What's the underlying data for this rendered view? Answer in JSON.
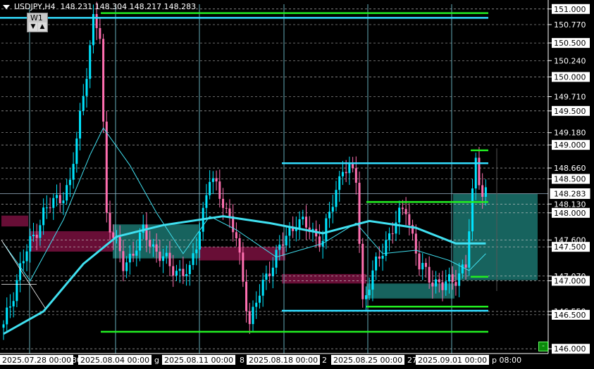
{
  "header": {
    "symbol_tf": "USDJPY,H4",
    "ohlc": "148.231 148.304 148.217 148.283"
  },
  "panel": {
    "label": "W1",
    "down_arrow": "▼",
    "up_arrow": "▲"
  },
  "colors": {
    "background": "#000000",
    "bull": "#00e5ff",
    "bear": "#ff6fb0",
    "ma_fast": "#40e0f0",
    "ma_slow": "#40e0f0",
    "level_cyan": "#33ddff",
    "level_green": "#22ee22",
    "zone_teal": "#1a6e68",
    "zone_maroon": "#7a1040",
    "price_tag_bg": "#ffffff"
  },
  "chart_data": {
    "type": "candlestick",
    "y_range": [
      145.93,
      151.07
    ],
    "y_ticks": [
      "151.000",
      "150.770",
      "150.500",
      "150.240",
      "150.000",
      "149.710",
      "149.500",
      "149.180",
      "149.000",
      "148.660",
      "148.500",
      "148.130",
      "148.000",
      "147.600",
      "147.500",
      "147.070",
      "147.000",
      "146.550",
      "146.500",
      "146.000"
    ],
    "current_price": "148.283",
    "x_labels": [
      "2025.07.28 00:00",
      "2025.08.04 00:00",
      "2025.08.11 00:00",
      "2025.08.18 00:00",
      "2025.08.25 00:00",
      "2025.09.01 00:00"
    ],
    "x_label_fragments": [
      "30",
      "g",
      "8",
      "2",
      "27",
      "p 08:00"
    ],
    "bars_count": 161,
    "key_points": [
      {
        "bar": 0,
        "price": 146.3
      },
      {
        "bar": 5,
        "price": 147.2
      },
      {
        "bar": 12,
        "price": 148.0
      },
      {
        "bar": 20,
        "price": 148.4
      },
      {
        "bar": 27,
        "price": 150.8
      },
      {
        "bar": 29,
        "price": 150.6
      },
      {
        "bar": 31,
        "price": 148.0
      },
      {
        "bar": 36,
        "price": 147.2
      },
      {
        "bar": 42,
        "price": 147.7
      },
      {
        "bar": 50,
        "price": 147.2
      },
      {
        "bar": 56,
        "price": 147.1
      },
      {
        "bar": 62,
        "price": 148.5
      },
      {
        "bar": 66,
        "price": 148.2
      },
      {
        "bar": 70,
        "price": 147.6
      },
      {
        "bar": 74,
        "price": 146.4
      },
      {
        "bar": 80,
        "price": 147.2
      },
      {
        "bar": 88,
        "price": 147.9
      },
      {
        "bar": 96,
        "price": 147.6
      },
      {
        "bar": 102,
        "price": 148.7
      },
      {
        "bar": 106,
        "price": 148.5
      },
      {
        "bar": 108,
        "price": 146.7
      },
      {
        "bar": 115,
        "price": 147.6
      },
      {
        "bar": 121,
        "price": 148.1
      },
      {
        "bar": 125,
        "price": 147.2
      },
      {
        "bar": 132,
        "price": 146.9
      },
      {
        "bar": 139,
        "price": 147.2
      },
      {
        "bar": 142,
        "price": 148.8
      },
      {
        "bar": 144,
        "price": 148.3
      },
      {
        "bar": 145,
        "price": 148.28
      }
    ],
    "ma_slow": [
      {
        "bar": 0,
        "price": 146.22
      },
      {
        "bar": 12,
        "price": 146.55
      },
      {
        "bar": 24,
        "price": 147.25
      },
      {
        "bar": 34,
        "price": 147.65
      },
      {
        "bar": 48,
        "price": 147.82
      },
      {
        "bar": 66,
        "price": 147.95
      },
      {
        "bar": 80,
        "price": 147.85
      },
      {
        "bar": 96,
        "price": 147.7
      },
      {
        "bar": 110,
        "price": 147.88
      },
      {
        "bar": 124,
        "price": 147.78
      },
      {
        "bar": 136,
        "price": 147.55
      },
      {
        "bar": 145,
        "price": 147.55
      }
    ],
    "ma_fast": [
      {
        "bar": 0,
        "price": 147.55
      },
      {
        "bar": 8,
        "price": 147.0
      },
      {
        "bar": 18,
        "price": 147.9
      },
      {
        "bar": 26,
        "price": 148.85
      },
      {
        "bar": 30,
        "price": 149.25
      },
      {
        "bar": 38,
        "price": 148.7
      },
      {
        "bar": 46,
        "price": 148.0
      },
      {
        "bar": 54,
        "price": 147.4
      },
      {
        "bar": 62,
        "price": 147.95
      },
      {
        "bar": 70,
        "price": 147.75
      },
      {
        "bar": 82,
        "price": 147.35
      },
      {
        "bar": 96,
        "price": 147.55
      },
      {
        "bar": 106,
        "price": 147.85
      },
      {
        "bar": 114,
        "price": 147.4
      },
      {
        "bar": 124,
        "price": 147.45
      },
      {
        "bar": 134,
        "price": 147.3
      },
      {
        "bar": 140,
        "price": 147.15
      },
      {
        "bar": 145,
        "price": 147.4
      }
    ],
    "levels": [
      {
        "color": "cyan",
        "price": 150.87,
        "from": 0,
        "to": 693
      },
      {
        "color": "green",
        "price": 150.94,
        "from": 143,
        "to": 693
      },
      {
        "color": "cyan",
        "price": 148.73,
        "from": 400,
        "to": 693
      },
      {
        "color": "green",
        "price": 148.16,
        "from": 520,
        "to": 693
      },
      {
        "color": "green",
        "price": 147.06,
        "from": 668,
        "to": 693
      },
      {
        "color": "cyan",
        "price": 146.56,
        "from": 400,
        "to": 693
      },
      {
        "color": "green",
        "price": 146.62,
        "from": 520,
        "to": 693
      },
      {
        "color": "green",
        "price": 146.25,
        "from": 143,
        "to": 693
      },
      {
        "color": "green",
        "price": 148.92,
        "from": 668,
        "to": 693
      }
    ],
    "zones": [
      {
        "kind": "teal",
        "p1": 147.83,
        "p2": 147.33,
        "x1": 160,
        "x2": 282
      },
      {
        "kind": "maroon",
        "p1": 147.73,
        "p2": 147.43,
        "x1": 42,
        "x2": 160
      },
      {
        "kind": "maroon",
        "p1": 147.96,
        "p2": 147.8,
        "x1": 2,
        "x2": 40
      },
      {
        "kind": "maroon",
        "p1": 147.5,
        "p2": 147.3,
        "x1": 282,
        "x2": 405
      },
      {
        "kind": "maroon",
        "p1": 147.1,
        "p2": 146.96,
        "x1": 400,
        "x2": 520
      },
      {
        "kind": "teal",
        "p1": 146.96,
        "p2": 146.74,
        "x1": 520,
        "x2": 645
      },
      {
        "kind": "teal",
        "p1": 148.28,
        "p2": 147.01,
        "x1": 643,
        "x2": 763
      }
    ]
  }
}
